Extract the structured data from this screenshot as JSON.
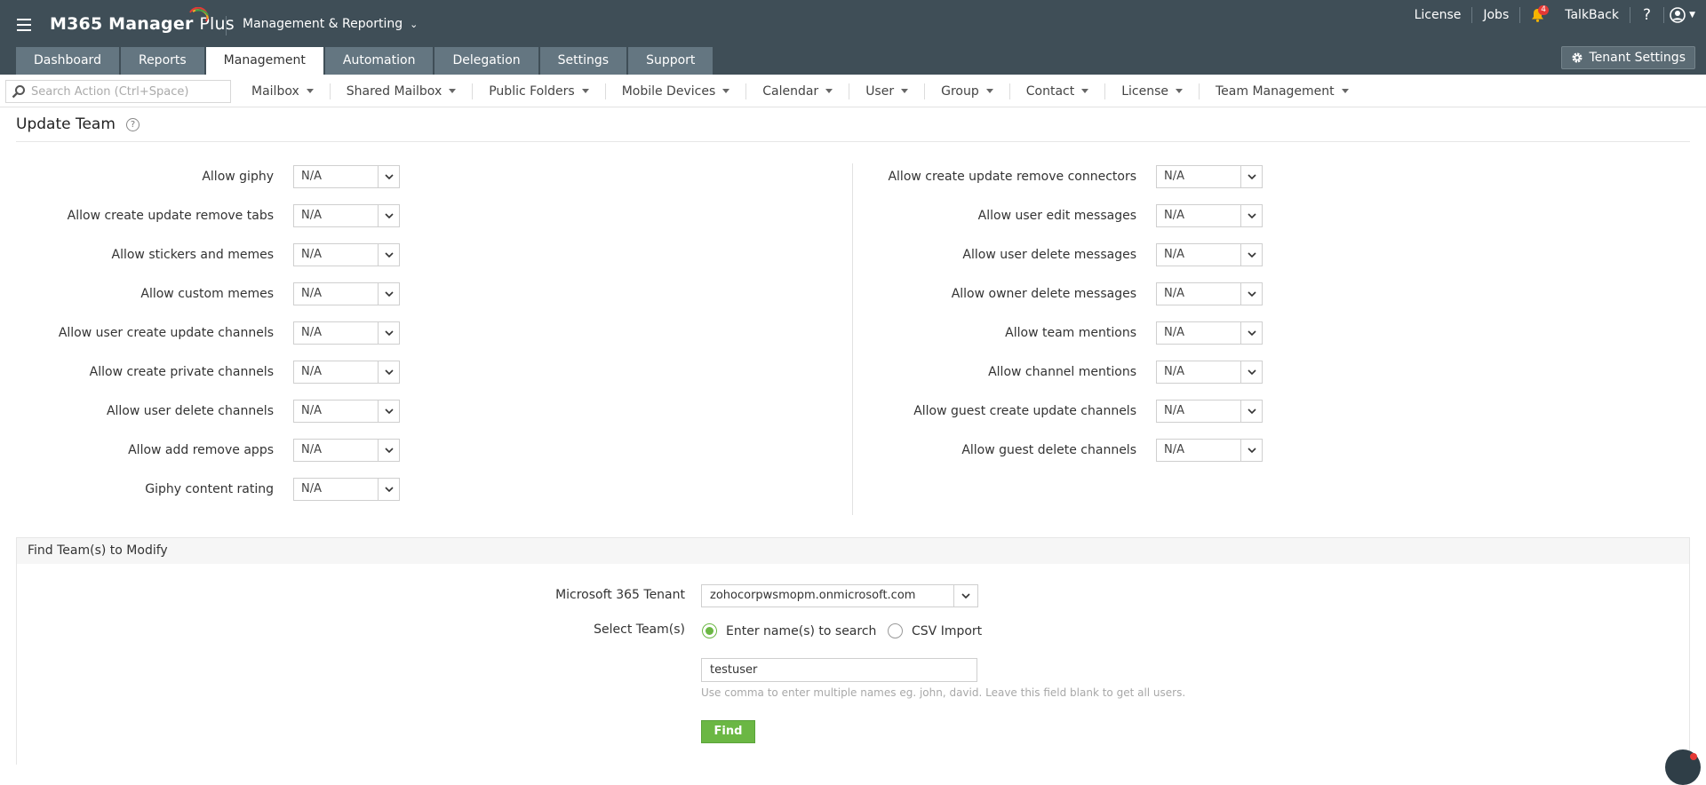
{
  "header": {
    "brand_name": "M365 Manager",
    "brand_suffix": "Plus",
    "module_switch": "Management & Reporting",
    "links": {
      "license": "License",
      "jobs": "Jobs",
      "talkback": "TalkBack",
      "help": "?"
    },
    "notification_count": "4",
    "tenant_settings": "Tenant Settings"
  },
  "tabs": [
    {
      "label": "Dashboard",
      "active": false
    },
    {
      "label": "Reports",
      "active": false
    },
    {
      "label": "Management",
      "active": true
    },
    {
      "label": "Automation",
      "active": false
    },
    {
      "label": "Delegation",
      "active": false
    },
    {
      "label": "Settings",
      "active": false
    },
    {
      "label": "Support",
      "active": false
    }
  ],
  "search": {
    "placeholder": "Search Action (Ctrl+Space)"
  },
  "submenu": [
    "Mailbox",
    "Shared Mailbox",
    "Public Folders",
    "Mobile Devices",
    "Calendar",
    "User",
    "Group",
    "Contact",
    "License",
    "Team Management"
  ],
  "page": {
    "title": "Update Team",
    "help": "?"
  },
  "left_fields": [
    {
      "label": "Allow giphy",
      "value": "N/A"
    },
    {
      "label": "Allow create update remove tabs",
      "value": "N/A"
    },
    {
      "label": "Allow stickers and memes",
      "value": "N/A"
    },
    {
      "label": "Allow custom memes",
      "value": "N/A"
    },
    {
      "label": "Allow user create update channels",
      "value": "N/A"
    },
    {
      "label": "Allow create private channels",
      "value": "N/A"
    },
    {
      "label": "Allow user delete channels",
      "value": "N/A"
    },
    {
      "label": "Allow add remove apps",
      "value": "N/A"
    },
    {
      "label": "Giphy content rating",
      "value": "N/A"
    }
  ],
  "right_fields": [
    {
      "label": "Allow create update remove connectors",
      "value": "N/A"
    },
    {
      "label": "Allow user edit messages",
      "value": "N/A"
    },
    {
      "label": "Allow user delete messages",
      "value": "N/A"
    },
    {
      "label": "Allow owner delete messages",
      "value": "N/A"
    },
    {
      "label": "Allow team mentions",
      "value": "N/A"
    },
    {
      "label": "Allow channel mentions",
      "value": "N/A"
    },
    {
      "label": "Allow guest create update channels",
      "value": "N/A"
    },
    {
      "label": "Allow guest delete channels",
      "value": "N/A"
    }
  ],
  "find": {
    "heading": "Find Team(s) to Modify",
    "tenant_label": "Microsoft 365 Tenant",
    "tenant_value": "zohocorpwsmopm.onmicrosoft.com",
    "select_label": "Select Team(s)",
    "option_search": "Enter name(s) to search",
    "option_csv": "CSV Import",
    "selected_option": "search",
    "input_value": "testuser",
    "hint": "Use comma to enter multiple names eg. john, david. Leave this field blank to get all users.",
    "button": "Find"
  },
  "colors": {
    "header_bg": "#3f4e57",
    "tab_bg": "#647681",
    "accent_green": "#6bb744",
    "badge_red": "#e53935"
  }
}
